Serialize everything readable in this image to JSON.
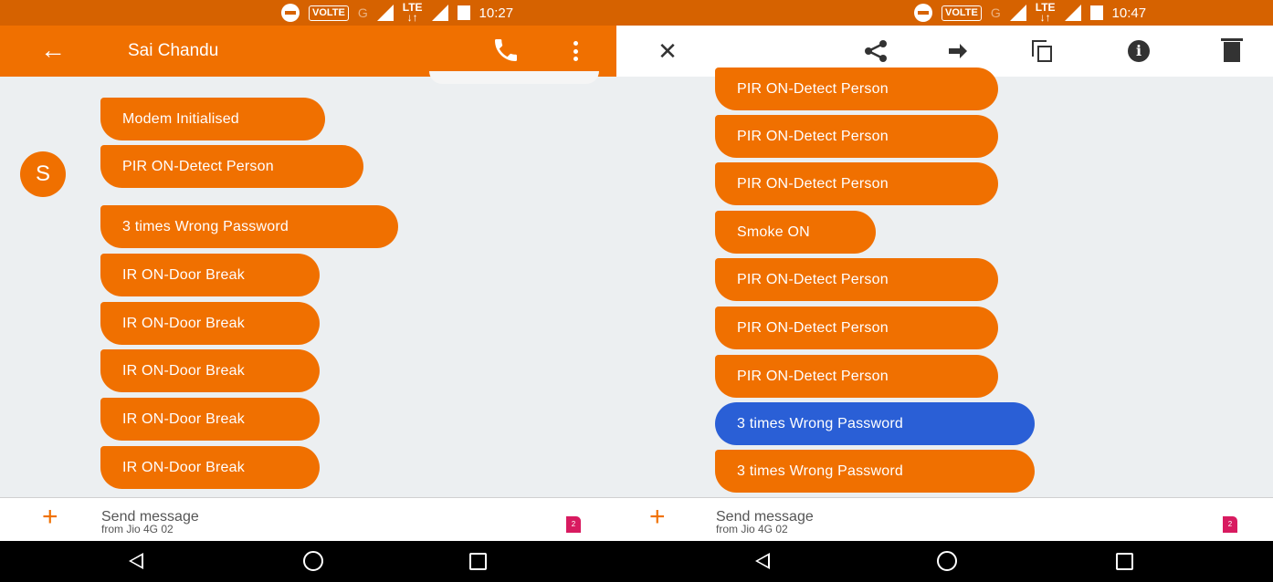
{
  "left": {
    "status": {
      "volte": "VOLTE",
      "net": "G",
      "lte_top": "LTE",
      "lte_bottom": "↓↑",
      "time": "10:27"
    },
    "appbar": {
      "back_icon": "←",
      "title": "Sai Chandu"
    },
    "avatar_letter": "S",
    "messages": [
      "Modem Initialised",
      "PIR ON-Detect Person",
      "3 times Wrong Password",
      "IR ON-Door Break",
      "IR ON-Door Break",
      "IR ON-Door Break",
      "IR ON-Door Break",
      "IR ON-Door Break"
    ],
    "compose": {
      "plus": "+",
      "placeholder": "Send message",
      "sub": "from Jio 4G 02",
      "sim_badge": "2"
    }
  },
  "right": {
    "status": {
      "volte": "VOLTE",
      "net": "G",
      "lte_top": "LTE",
      "lte_bottom": "↓↑",
      "time": "10:47"
    },
    "selbar": {
      "close_icon": "✕",
      "info_icon": "i"
    },
    "messages": [
      "PIR ON-Detect Person",
      "PIR ON-Detect Person",
      "PIR ON-Detect Person",
      "Smoke ON",
      "PIR ON-Detect Person",
      "PIR ON-Detect Person",
      "PIR ON-Detect Person",
      "3 times Wrong Password",
      "3 times Wrong Password"
    ],
    "selected_message_index": 7,
    "compose": {
      "plus": "+",
      "placeholder": "Send message",
      "sub": "from Jio 4G 02",
      "sim_badge": "2"
    }
  },
  "colors": {
    "accent": "#f07000",
    "status_bar": "#d66200",
    "selected_bubble": "#2a5fd6",
    "background": "#eceff1",
    "sim_badge": "#d81b60"
  },
  "icons": [
    "back-arrow-icon",
    "phone-icon",
    "more-vert-icon",
    "close-icon",
    "share-icon",
    "forward-icon",
    "copy-icon",
    "info-icon",
    "delete-icon",
    "add-icon",
    "sim-card-icon",
    "nav-back-icon",
    "nav-home-icon",
    "nav-recents-icon"
  ]
}
